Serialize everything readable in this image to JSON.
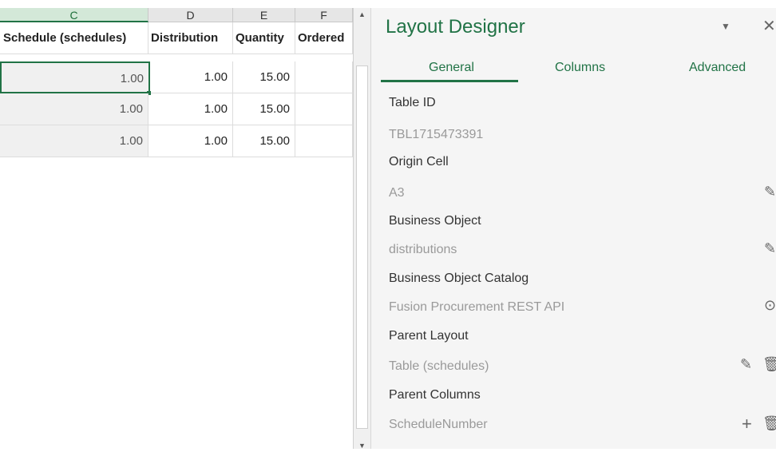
{
  "sheet": {
    "columns": [
      "C",
      "D",
      "E",
      "F"
    ],
    "headers": [
      "Schedule (schedules)",
      "Distribution",
      "Quantity",
      "Ordered"
    ],
    "rows": [
      [
        "1.00",
        "1.00",
        "15.00",
        ""
      ],
      [
        "1.00",
        "1.00",
        "15.00",
        ""
      ],
      [
        "1.00",
        "1.00",
        "15.00",
        ""
      ]
    ]
  },
  "pane": {
    "title": "Layout Designer",
    "menu_glyph": "▼",
    "close_glyph": "✕",
    "tabs": [
      "General",
      "Columns",
      "Advanced"
    ],
    "active_tab": "General",
    "fields": [
      {
        "label": "Table ID",
        "value": "TBL1715473391",
        "actions": []
      },
      {
        "label": "Origin Cell",
        "value": "A3",
        "actions": [
          "pencil-icon"
        ]
      },
      {
        "label": "Business Object",
        "value": "distributions",
        "actions": [
          "pencil-icon"
        ]
      },
      {
        "label": "Business Object Catalog",
        "value": "Fusion Procurement REST API",
        "actions": [
          "view-icon"
        ]
      },
      {
        "label": "Parent Layout",
        "value": "Table (schedules)",
        "actions": [
          "pencil-icon",
          "trash-icon"
        ]
      },
      {
        "label": "Parent Columns",
        "value": "ScheduleNumber",
        "actions": [
          "plus-icon",
          "trash-icon"
        ]
      }
    ]
  },
  "colors": {
    "accent": "#217346",
    "pane_bg": "#f5f5f5",
    "muted_text": "#9a9a9a"
  }
}
